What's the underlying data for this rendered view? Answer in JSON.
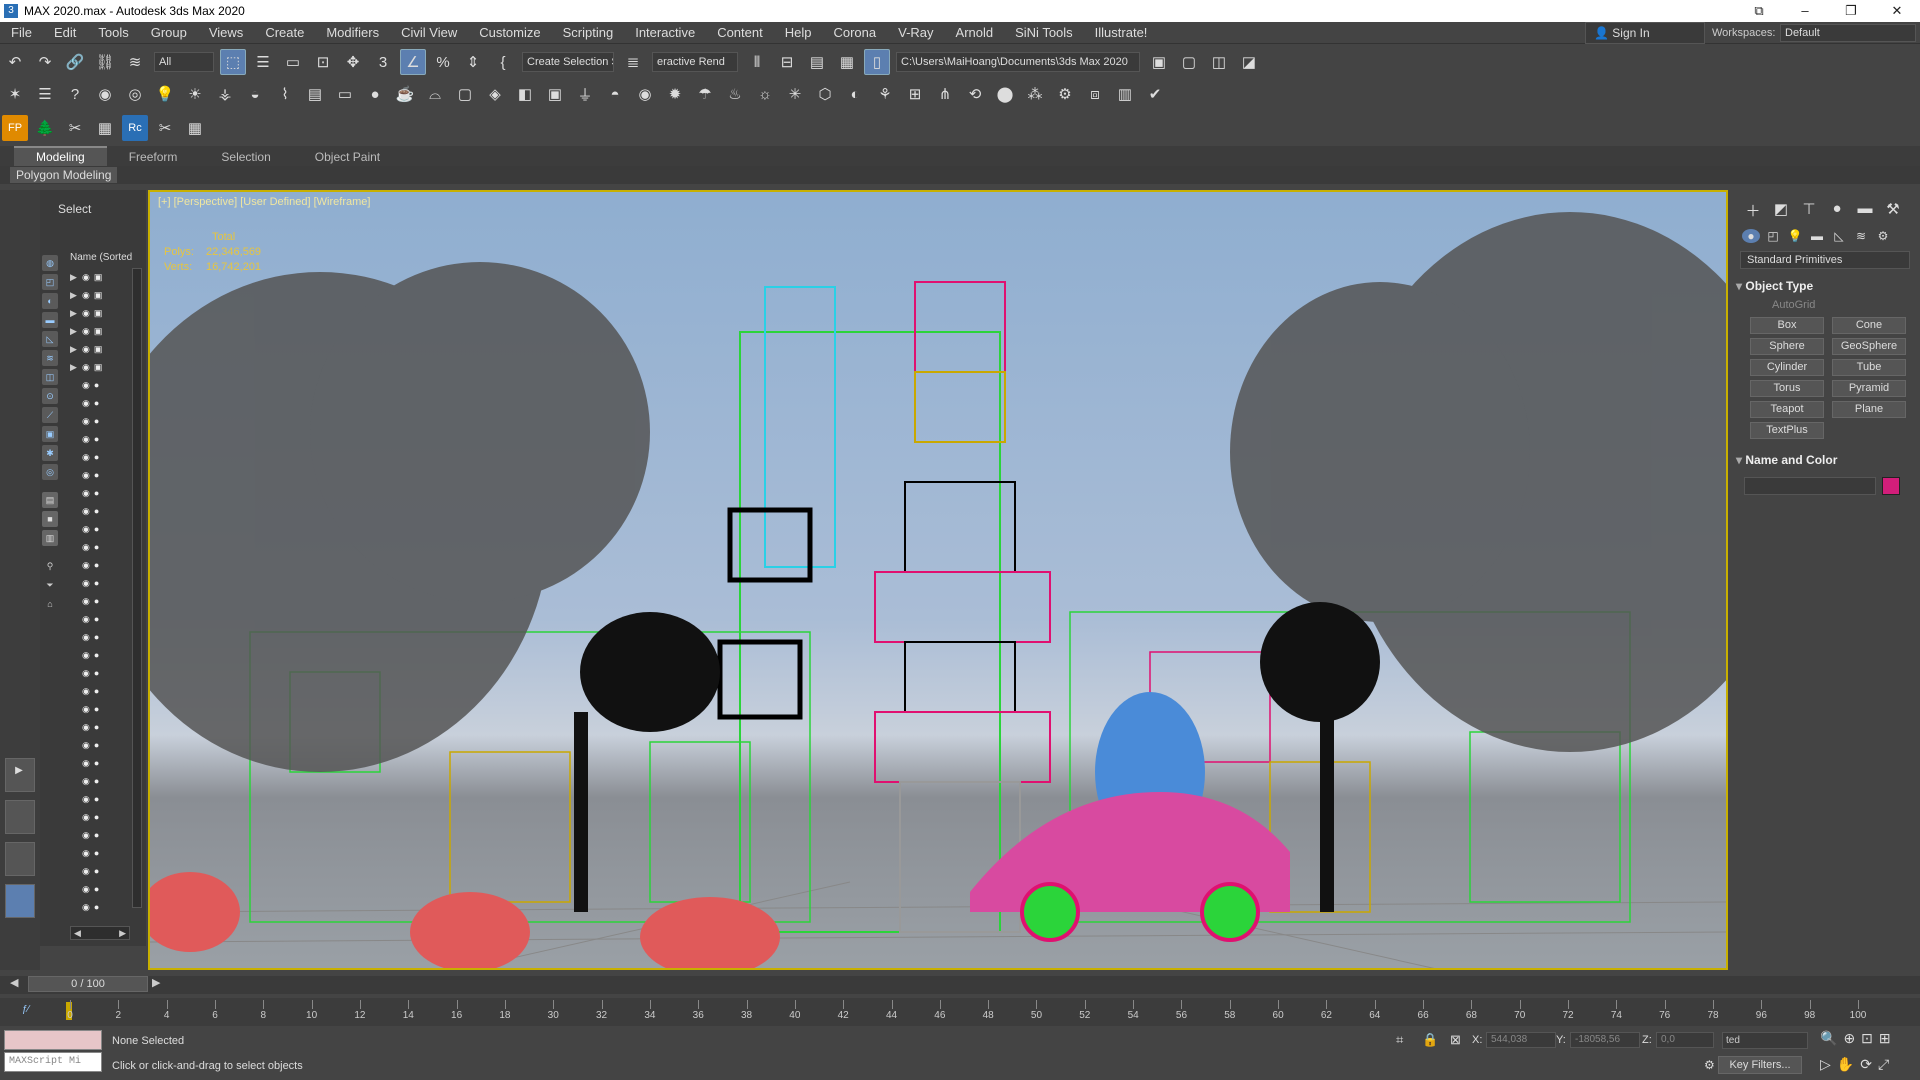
{
  "window": {
    "title": "MAX 2020.max - Autodesk 3ds Max 2020",
    "app_icon": "3"
  },
  "menu": [
    "File",
    "Edit",
    "Tools",
    "Group",
    "Views",
    "Create",
    "Modifiers",
    "Civil View",
    "Customize",
    "Scripting",
    "Interactive",
    "Content",
    "Help",
    "Corona",
    "V-Ray",
    "Arnold",
    "SiNi Tools",
    "Illustrate!"
  ],
  "account": {
    "sign_in": "Sign In",
    "workspaces_label": "Workspaces:",
    "workspace_value": "Default"
  },
  "toolbar": {
    "filter": "All",
    "selection_set": "Create Selection Se",
    "interactive_renderer": "eractive Rend",
    "project_path": "C:\\Users\\MaiHoang\\Documents\\3ds Max 2020"
  },
  "ribbon": {
    "tabs": [
      "Modeling",
      "Freeform",
      "Selection",
      "Object Paint"
    ],
    "panel": "Polygon Modeling"
  },
  "scene_explorer": {
    "select_label": "Select",
    "column_header": "Name (Sorted"
  },
  "viewport": {
    "label": "[+] [Perspective] [User Defined] [Wireframe]",
    "stats_total": "Total",
    "polys_label": "Polys:",
    "polys_value": "22,346,569",
    "verts_label": "Verts:",
    "verts_value": "16,742,201"
  },
  "command_panel": {
    "dropdown": "Standard Primitives",
    "object_type": "Object Type",
    "autogrid": "AutoGrid",
    "primitives": [
      "Box",
      "Cone",
      "Sphere",
      "GeoSphere",
      "Cylinder",
      "Tube",
      "Torus",
      "Pyramid",
      "Teapot",
      "Plane",
      "TextPlus"
    ],
    "name_and_color": "Name and Color",
    "color_swatch": "#d21e7a"
  },
  "timeline": {
    "frame": "0 / 100",
    "ticks": [
      "0",
      "2",
      "4",
      "6",
      "8",
      "10",
      "12",
      "14",
      "16",
      "18",
      "30",
      "32",
      "34",
      "36",
      "38",
      "40",
      "42",
      "44",
      "46",
      "48",
      "50",
      "52",
      "54",
      "56",
      "58",
      "60",
      "62",
      "64",
      "66",
      "68",
      "70",
      "72",
      "74",
      "76",
      "78",
      "96",
      "98",
      "100"
    ]
  },
  "status": {
    "selection": "None Selected",
    "prompt": "Click or click-and-drag to select objects",
    "maxscript": "MAXScript Mi",
    "x_label": "X:",
    "x_value": "544,038",
    "y_label": "Y:",
    "y_value": "-18058,56",
    "z_label": "Z:",
    "z_value": "0,0",
    "set_key": "ted",
    "key_filters": "Key Filters..."
  }
}
